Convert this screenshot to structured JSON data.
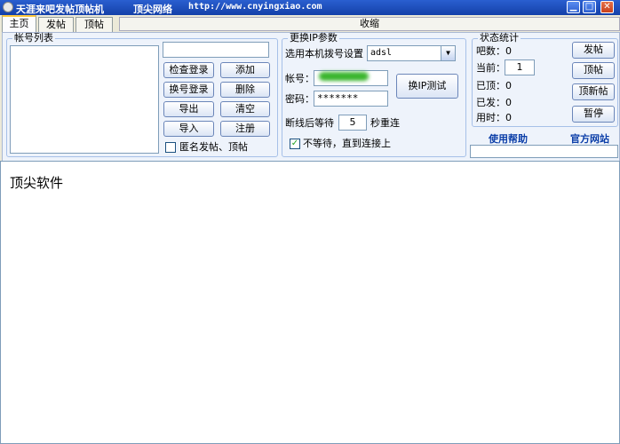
{
  "window": {
    "title": "天涯来吧发帖顶帖机",
    "company": "顶尖网络",
    "url": "http://www.cnyingxiao.com",
    "minimize": "▁",
    "maximize": "□",
    "close": "✕"
  },
  "tabs": [
    {
      "label": "主页",
      "active": true
    },
    {
      "label": "发帖",
      "active": false
    },
    {
      "label": "顶帖",
      "active": false
    }
  ],
  "shrink_label": "收缩",
  "accounts": {
    "group_title": "帐号列表",
    "search_value": "",
    "buttons": {
      "check_login": "检查登录",
      "add": "添加",
      "switch_login": "换号登录",
      "delete": "删除",
      "export": "导出",
      "clear": "清空",
      "import": "导入",
      "register": "注册"
    },
    "anonymous_label": "匿名发帖、顶帖",
    "anonymous_checked": false
  },
  "ip": {
    "group_title": "更换IP参数",
    "dial_label": "选用本机拨号设置",
    "dial_value": "adsl",
    "account_label": "帐号：",
    "account_value": "",
    "password_label": "密码：",
    "password_value": "*******",
    "test_button": "换IP测试",
    "wait_prefix": "断线后等待",
    "wait_value": "5",
    "wait_suffix": "秒重连",
    "nowait_label": "不等待，直到连接上",
    "nowait_checked": true
  },
  "stats": {
    "group_title": "状态统计",
    "bar_count_label": "吧数：",
    "bar_count_value": "0",
    "current_label": "当前：",
    "current_value": "1",
    "topped_label": "已顶：",
    "topped_value": "0",
    "posted_label": "已发：",
    "posted_value": "0",
    "time_label": "用时：",
    "time_value": "0",
    "buttons": {
      "post": "发帖",
      "top": "顶帖",
      "top_new": "顶新帖",
      "pause": "暂停"
    }
  },
  "links": {
    "help": "使用帮助",
    "official_site": "官方网站"
  },
  "status_value": "",
  "log_text": "顶尖软件",
  "colors": {
    "titlebar": "#1f4fbf",
    "panel_bg": "#eef3fb",
    "link": "#0b3ea8",
    "tab_highlight": "#ffc83c"
  }
}
